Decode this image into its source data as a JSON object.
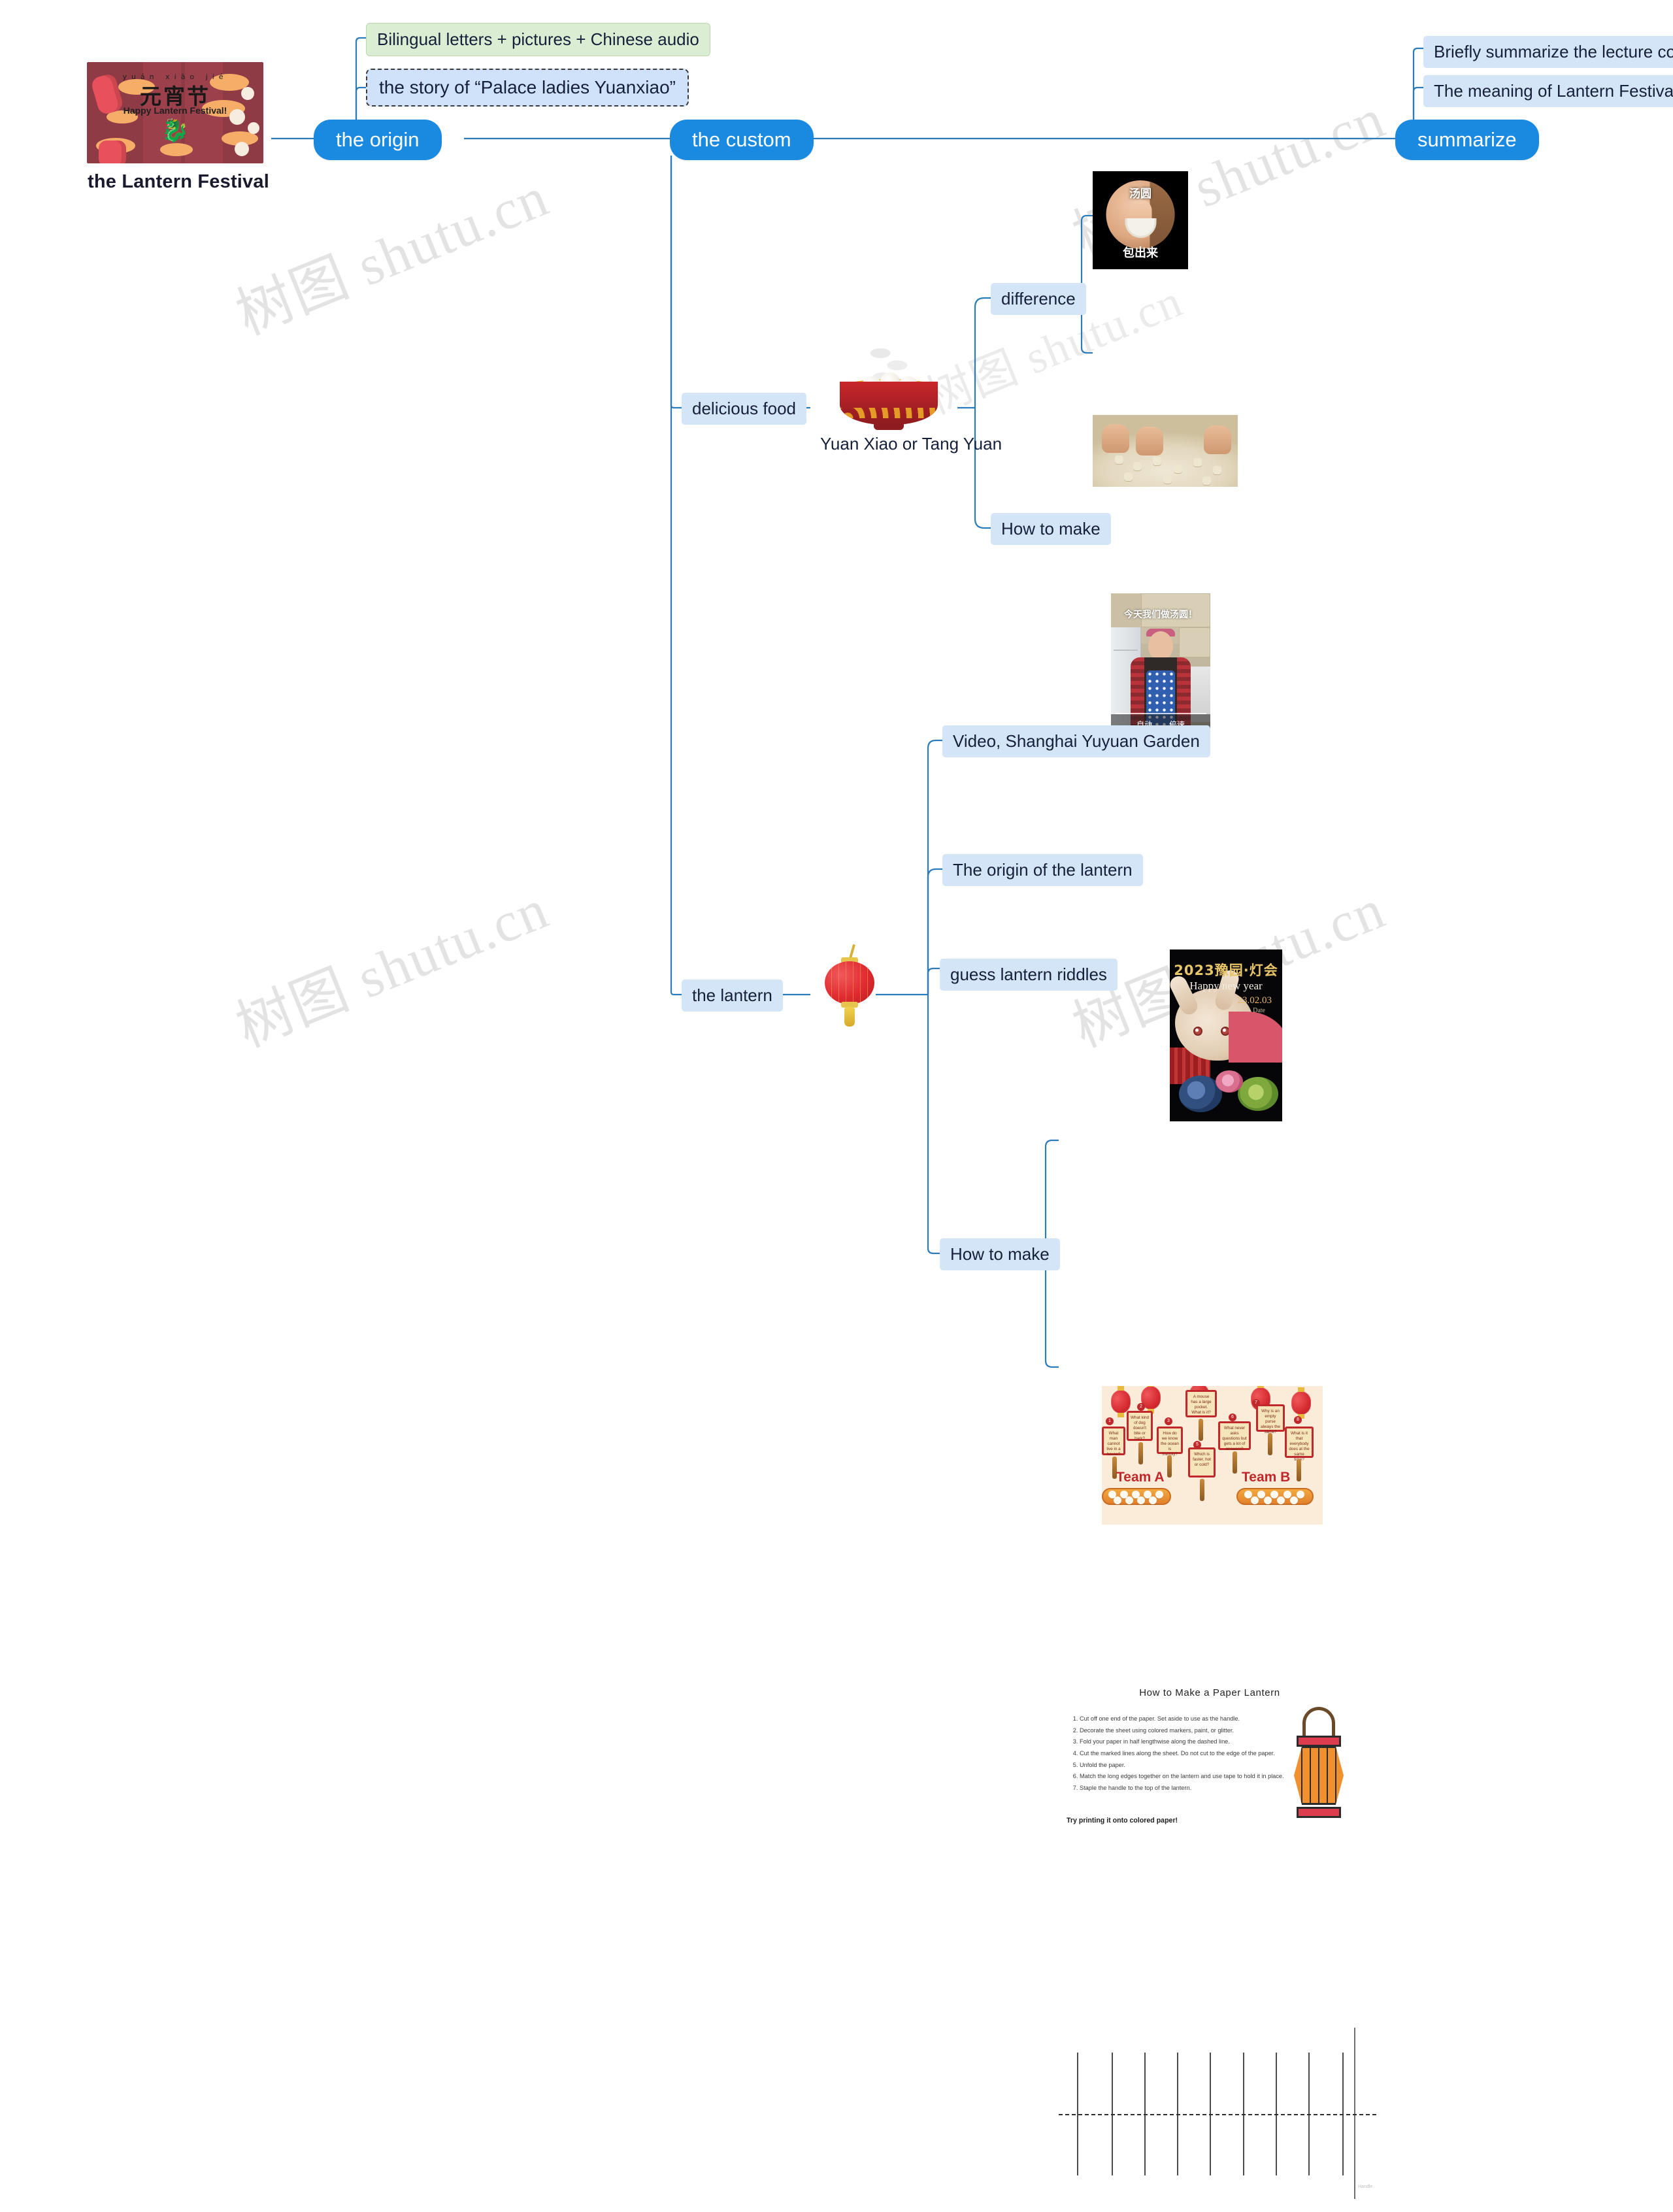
{
  "watermark": {
    "text": "树图 shutu.cn"
  },
  "root": {
    "title": "the Lantern Festival",
    "poster": {
      "pinyin": "yuán xiāo jié",
      "chinese": "元宵节",
      "english": "Happy Lantern Festival!"
    }
  },
  "branches": {
    "origin": {
      "label": "the origin",
      "children": [
        {
          "label": "Bilingual letters + pictures + Chinese audio",
          "style": "green"
        },
        {
          "label": "the story of  “Palace ladies Yuanxiao”",
          "style": "dashed"
        }
      ]
    },
    "custom": {
      "label": "the custom",
      "food": {
        "label": "delicious food",
        "image_caption": "Yuan Xiao or Tang Yuan",
        "children": [
          {
            "label": "difference"
          },
          {
            "label": "How to make"
          }
        ],
        "difference_images": [
          {
            "name": "tangyuan-video-thumbnail",
            "top_text": "汤圆",
            "bottom_text": "包出来"
          },
          {
            "name": "rolling-yuanxiao-photo"
          }
        ],
        "howto_image": {
          "name": "kitchen-video-thumbnail",
          "overlay_text": "今天我们做汤圆！",
          "control_left": "自动",
          "control_right": "倍速"
        }
      },
      "lantern": {
        "label": "the lantern",
        "children": [
          {
            "label": "Video, Shanghai Yuyuan Garden"
          },
          {
            "label": "The origin of the lantern"
          },
          {
            "label": "guess lantern riddles"
          },
          {
            "label": "How to make"
          }
        ],
        "yuyuan_poster": {
          "title": "2023豫园·灯会",
          "greeting": "Happy new year",
          "date": "23.02.03",
          "date_label": "Date"
        },
        "riddles_poster": {
          "team_a": "Team A",
          "team_b": "Team B",
          "riddles": [
            {
              "num": "1",
              "text": "What man cannot live in a house?"
            },
            {
              "num": "2",
              "text": "What kind of dog doesn't bite or bark?"
            },
            {
              "num": "3",
              "text": "How do we know the ocean is friendly?"
            },
            {
              "num": "4",
              "text": "A mouse has a large pocket. What is it?"
            },
            {
              "num": "5",
              "text": "Which is faster, hot or cold?"
            },
            {
              "num": "6",
              "text": "What never asks questions but gets a lot of answers?"
            },
            {
              "num": "7",
              "text": "Why is an empty purse always the same?"
            },
            {
              "num": "8",
              "text": "What is it that everybody does at the same time?"
            }
          ]
        },
        "howto_sheet": {
          "title": "How to Make a Paper Lantern",
          "steps": [
            "Cut off one end of the paper. Set aside to use as the handle.",
            "Decorate the sheet using colored markers, paint, or glitter.",
            "Fold your paper in half lengthwise along the dashed line.",
            "Cut the marked lines along the sheet. Do not cut to the edge of the paper.",
            "Unfold the paper.",
            "Match the long edges together on the lantern and use tape to hold it in place.",
            "Staple the handle to the top of the lantern."
          ],
          "footer": "Try printing it onto colored paper!"
        },
        "cut_template": {
          "handle_label": "Handle"
        }
      }
    },
    "summarize": {
      "label": "summarize",
      "children": [
        {
          "label": "Briefly summarize the lecture content"
        },
        {
          "label": "The meaning of Lantern Festival"
        }
      ]
    }
  },
  "colors": {
    "node_blue": "#1a8ae0",
    "chip_blue": "#d4e5f7",
    "chip_green": "#dbedd3",
    "link": "#2b7bb9"
  }
}
